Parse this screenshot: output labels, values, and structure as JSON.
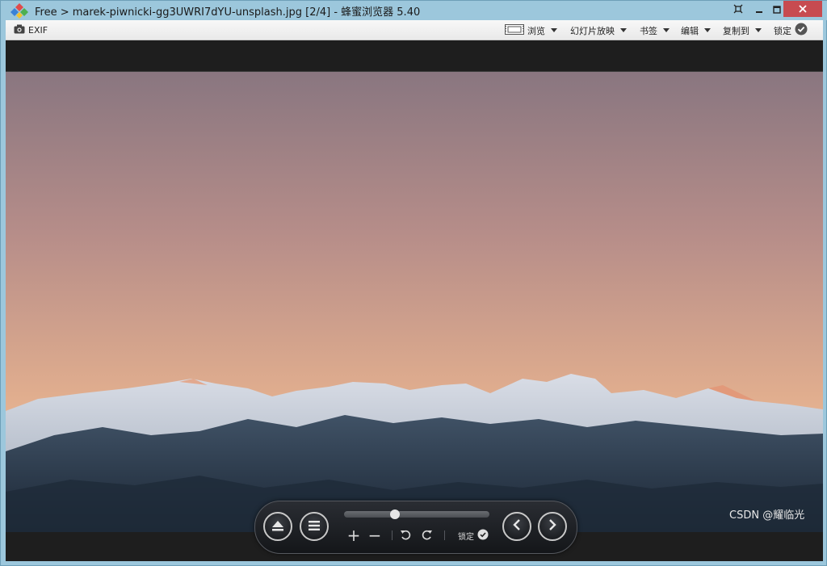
{
  "window": {
    "title": "Free > marek-piwnicki-gg3UWRI7dYU-unsplash.jpg [2/4] - 蜂蜜浏览器 5.40"
  },
  "toolbar": {
    "exif_label": "EXIF",
    "browse_label": "浏览",
    "slideshow_label": "幻灯片放映",
    "bookmark_label": "书签",
    "edit_label": "编辑",
    "copyto_label": "复制到",
    "lock_label": "锁定"
  },
  "controls": {
    "zoom_position": 0.35,
    "zoom_in_symbol": "+",
    "zoom_out_symbol": "−",
    "lock_label": "锁定"
  },
  "watermark": "CSDN @耀临光",
  "colors": {
    "titlebar": "#9cc7dc",
    "close_button": "#c74b50",
    "viewer_bg": "#1e1e1e"
  },
  "icons": [
    "app-logo-icon",
    "pin-icon",
    "minimize-icon",
    "maximize-icon",
    "close-icon",
    "camera-icon",
    "filmstrip-icon",
    "check-circle-icon",
    "eject-icon",
    "menu-icon",
    "zoom-in-icon",
    "zoom-out-icon",
    "rotate-left-icon",
    "rotate-right-icon",
    "prev-icon",
    "next-icon"
  ]
}
